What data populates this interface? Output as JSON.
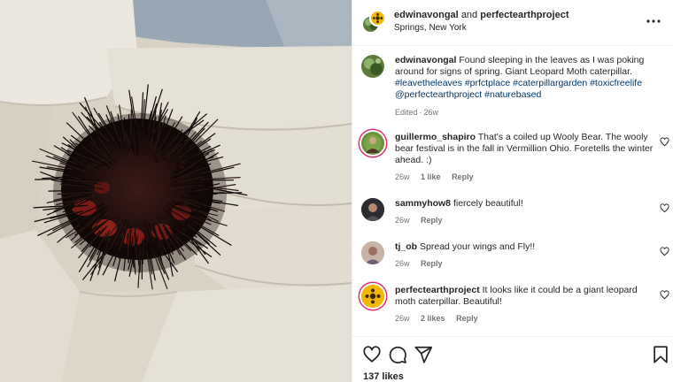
{
  "header": {
    "account_primary": "edwinavongal",
    "joiner": "and",
    "account_secondary": "perfectearthproject",
    "location": "Springs, New York",
    "more_icon": "more-horizontal-icon"
  },
  "caption": {
    "username": "edwinavongal",
    "text": "Found sleeping in the leaves as I was poking around for signs of spring. Giant Leopard Moth caterpillar.",
    "hashtags": [
      "#leavetheleaves",
      "#prfctplace",
      "#caterpillargarden",
      "#toxicfreelife"
    ],
    "mention": "@perfectearthproject",
    "hashtag_end": "#naturebased",
    "edited_label": "Edited",
    "time": "26w"
  },
  "comments": [
    {
      "username": "guillermo_shapiro",
      "text": "That's a coiled up Wooly Bear. The wooly bear festival is in the fall in Vermillion Ohio. Foretells the winter ahead. :)",
      "time": "26w",
      "likes": "1 like",
      "reply": "Reply",
      "avatar_color": "#6b8e3a"
    },
    {
      "username": "sammyhow8",
      "text": "fiercely beautiful!",
      "time": "26w",
      "likes": "",
      "reply": "Reply",
      "avatar_color": "#3c3a3e"
    },
    {
      "username": "tj_ob",
      "text": "Spread your wings and Fly!!",
      "time": "26w",
      "likes": "",
      "reply": "Reply",
      "avatar_color": "#b08a7a"
    },
    {
      "username": "perfectearthproject",
      "text": "It looks like it could be a giant leopard moth caterpillar. Beautiful!",
      "time": "26w",
      "likes": "2 likes",
      "reply": "Reply",
      "avatar_color": "#f2b705"
    }
  ],
  "actions": {
    "like_icon": "heart-icon",
    "comment_icon": "comment-icon",
    "share_icon": "send-icon",
    "save_icon": "bookmark-icon",
    "likes_count": "137 likes"
  },
  "colors": {
    "link_blue": "#00376b",
    "secondary_text": "#737373",
    "story_ring": "#e1306c"
  }
}
